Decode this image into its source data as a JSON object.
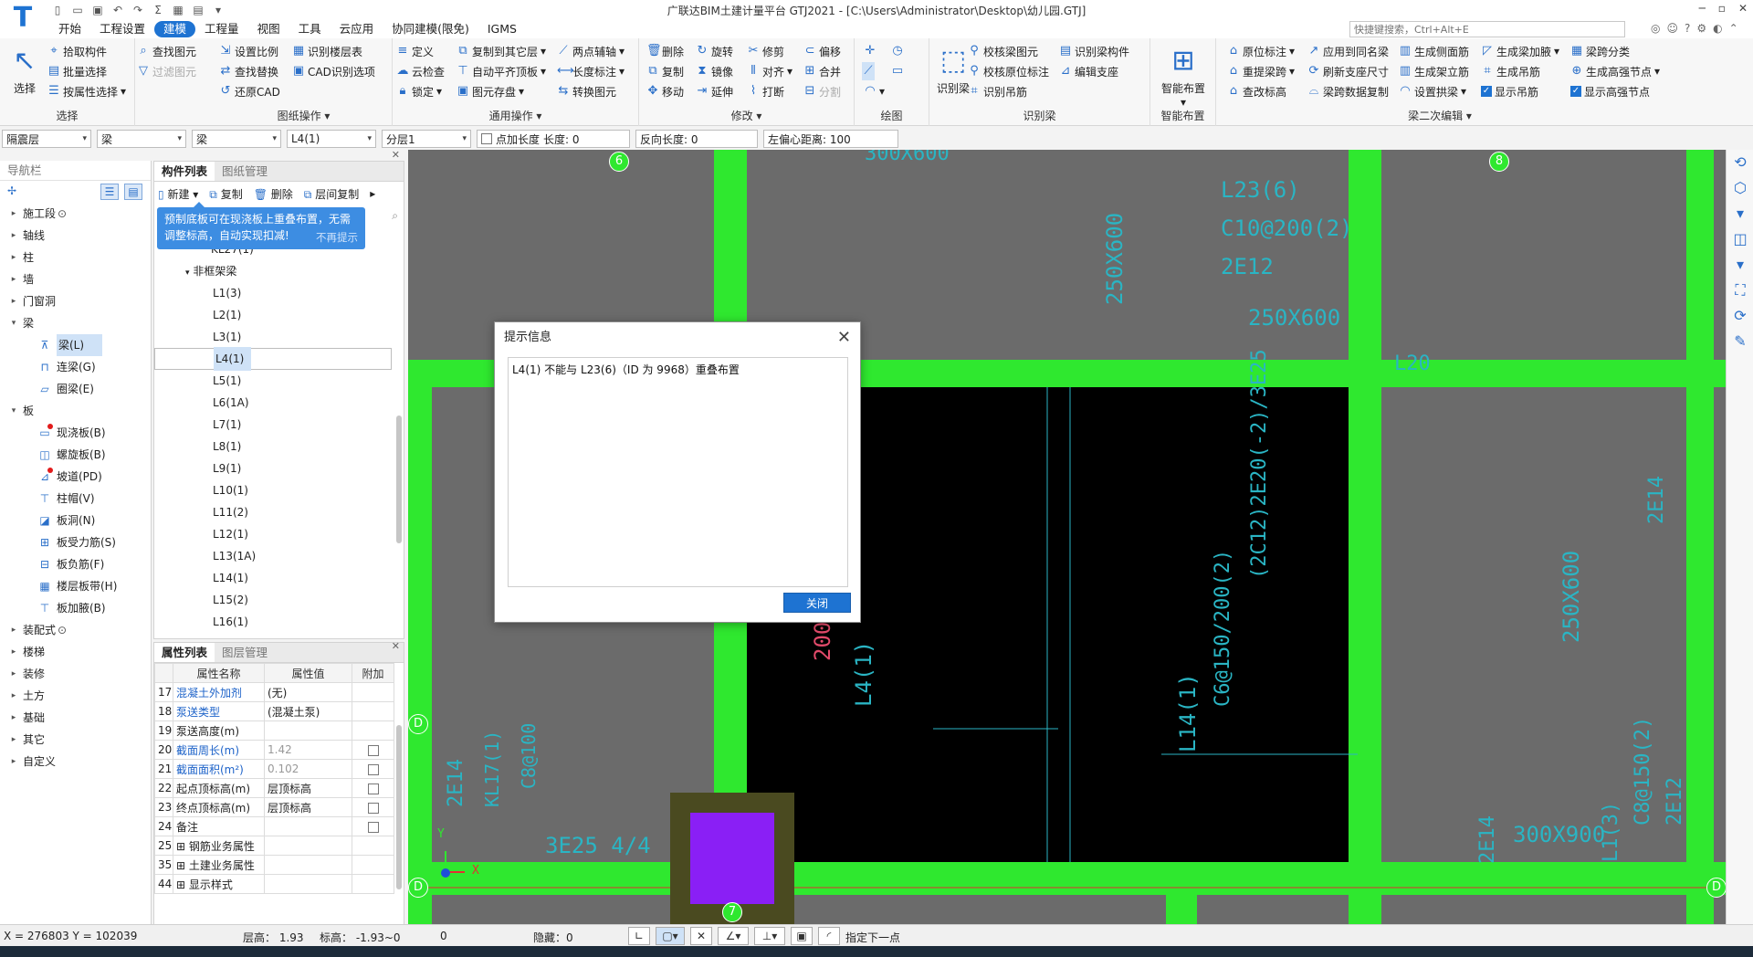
{
  "app": {
    "title": "广联达BIM土建计量平台 GTJ2021 - [C:\\Users\\Administrator\\Desktop\\幼儿园.GTJ]",
    "logo": "T"
  },
  "menus": [
    "开始",
    "工程设置",
    "建模",
    "工程量",
    "视图",
    "工具",
    "云应用",
    "协同建模(限免)",
    "IGMS"
  ],
  "active_menu": "建模",
  "search": {
    "placeholder": "快捷键搜索，Ctrl+Alt+E"
  },
  "ribbon": {
    "select": {
      "caption": "选择",
      "big": "选择",
      "items": [
        "拾取构件",
        "批量选择",
        "按属性选择",
        "查找图元",
        "过滤图元"
      ]
    },
    "drawing_ops": {
      "caption": "图纸操作",
      "items": [
        "设置比例",
        "查找替换",
        "还原CAD",
        "识别楼层表",
        "CAD识别选项"
      ]
    },
    "common_ops": {
      "caption": "通用操作",
      "items": [
        "定义",
        "云检查",
        "锁定",
        "复制到其它层",
        "自动平齐顶板",
        "图元存盘",
        "两点辅轴",
        "长度标注",
        "转换图元"
      ]
    },
    "modify": {
      "caption": "修改",
      "items": [
        "删除",
        "复制",
        "移动",
        "旋转",
        "镜像",
        "延伸",
        "修剪",
        "对齐",
        "打断",
        "偏移",
        "合并",
        "分割"
      ]
    },
    "draw": {
      "caption": "绘图"
    },
    "recognize_beam": {
      "caption": "识别梁",
      "big": "识别梁",
      "items": [
        "校核梁图元",
        "校核原位标注",
        "识别吊筋",
        "识别梁构件",
        "编辑支座"
      ]
    },
    "smart": {
      "caption": "智能布置",
      "big": "智能布置"
    },
    "beam_secondary": {
      "caption": "梁二次编辑",
      "items": [
        "原位标注",
        "重提梁跨",
        "查改标高",
        "应用到同名梁",
        "刷新支座尺寸",
        "梁跨数据复制",
        "生成侧面筋",
        "生成架立筋",
        "设置拱梁",
        "生成梁加腋",
        "生成吊筋",
        "显示吊筋",
        "梁跨分类",
        "生成高强节点",
        "显示高强节点"
      ]
    }
  },
  "filterbar": {
    "floor": "隔震层",
    "type1": "梁",
    "type2": "梁",
    "component": "L4(1)",
    "layer": "分层1",
    "add_length_label": "点加长度",
    "length_label": "长度: 0",
    "reverse_length": "反向长度: 0",
    "left_offset": "左偏心距离: 100"
  },
  "nav": {
    "title": "导航栏",
    "items": [
      {
        "label": "施工段",
        "suffix": "⊙",
        "level": 0
      },
      {
        "label": "轴线",
        "level": 0
      },
      {
        "label": "柱",
        "level": 0
      },
      {
        "label": "墙",
        "level": 0
      },
      {
        "label": "门窗洞",
        "level": 0
      },
      {
        "label": "梁",
        "level": 0,
        "open": true
      },
      {
        "label": "梁(L)",
        "level": 1,
        "icon": "beam-icon",
        "selected": true
      },
      {
        "label": "连梁(G)",
        "level": 1,
        "icon": "link-beam-icon"
      },
      {
        "label": "圈梁(E)",
        "level": 1,
        "icon": "ring-beam-icon"
      },
      {
        "label": "板",
        "level": 0,
        "open": true
      },
      {
        "label": "现浇板(B)",
        "level": 1,
        "icon": "slab-icon",
        "dot": true
      },
      {
        "label": "螺旋板(B)",
        "level": 1,
        "icon": "spiral-slab-icon"
      },
      {
        "label": "坡道(PD)",
        "level": 1,
        "icon": "ramp-icon",
        "dot": true
      },
      {
        "label": "柱帽(V)",
        "level": 1,
        "icon": "column-cap-icon"
      },
      {
        "label": "板洞(N)",
        "level": 1,
        "icon": "slab-hole-icon"
      },
      {
        "label": "板受力筋(S)",
        "level": 1,
        "icon": "slab-rebar-icon"
      },
      {
        "label": "板负筋(F)",
        "level": 1,
        "icon": "negative-rebar-icon"
      },
      {
        "label": "楼层板带(H)",
        "level": 1,
        "icon": "slab-band-icon"
      },
      {
        "label": "板加腋(B)",
        "level": 1,
        "icon": "slab-haunch-icon"
      },
      {
        "label": "装配式",
        "suffix": "⊙",
        "level": 0
      },
      {
        "label": "楼梯",
        "level": 0
      },
      {
        "label": "装修",
        "level": 0
      },
      {
        "label": "土方",
        "level": 0
      },
      {
        "label": "基础",
        "level": 0
      },
      {
        "label": "其它",
        "level": 0
      },
      {
        "label": "自定义",
        "level": 0
      }
    ]
  },
  "component_panel": {
    "tabs": [
      "构件列表",
      "图纸管理"
    ],
    "toolbar": [
      "新建",
      "复制",
      "删除",
      "层间复制"
    ],
    "tip": {
      "text": "预制底板可在现浇板上重叠布置，无需调整标高，自动实现扣减!",
      "dismiss": "不再提示"
    },
    "tree_top": "KL27(1)",
    "group": "非框架梁",
    "items": [
      "L1(3)",
      "L2(1)",
      "L3(1)",
      "L4(1)",
      "L5(1)",
      "L6(1A)",
      "L7(1)",
      "L8(1)",
      "L9(1)",
      "L10(1)",
      "L11(2)",
      "L12(1)",
      "L13(1A)",
      "L14(1)",
      "L15(2)",
      "L16(1)"
    ],
    "selected": "L4(1)"
  },
  "properties": {
    "tabs": [
      "属性列表",
      "图层管理"
    ],
    "headers": [
      "属性名称",
      "属性值",
      "附加"
    ],
    "rows": [
      {
        "n": "17",
        "name": "混凝土外加剂",
        "value": "(无)",
        "blue": true,
        "chk": false
      },
      {
        "n": "18",
        "name": "泵送类型",
        "value": "(混凝土泵)",
        "blue": true,
        "chk": false
      },
      {
        "n": "19",
        "name": "泵送高度(m)",
        "value": "",
        "blue": false,
        "chk": false
      },
      {
        "n": "20",
        "name": "截面周长(m)",
        "value": "1.42",
        "blue": true,
        "gray": true,
        "chk": true
      },
      {
        "n": "21",
        "name": "截面面积(m²)",
        "value": "0.102",
        "blue": true,
        "gray": true,
        "chk": true
      },
      {
        "n": "22",
        "name": "起点顶标高(m)",
        "value": "层顶标高",
        "blue": false,
        "chk": true
      },
      {
        "n": "23",
        "name": "终点顶标高(m)",
        "value": "层顶标高",
        "blue": false,
        "chk": true
      },
      {
        "n": "24",
        "name": "备注",
        "value": "",
        "blue": false,
        "chk": true
      },
      {
        "n": "25",
        "name": "钢筋业务属性",
        "value": "",
        "blue": false,
        "expand": true
      },
      {
        "n": "35",
        "name": "土建业务属性",
        "value": "",
        "blue": false,
        "expand": true
      },
      {
        "n": "44",
        "name": "显示样式",
        "value": "",
        "blue": false,
        "expand": true
      }
    ]
  },
  "canvas": {
    "axis_labels": [
      "6",
      "8",
      "7",
      "D",
      "D",
      "D"
    ],
    "texts": [
      "300X600",
      "250X600",
      "L23(6)",
      "C10@200(2)",
      "2E12",
      "250X600",
      "L20",
      "2E14",
      "250X600",
      "200X510",
      "L4(1)",
      "L14(1)",
      "C6@150/200(2)",
      "(2C12)2E20(-2)/3E25",
      "2E14",
      "2E14",
      "3E25 4/4",
      "300X900",
      "L1(3)",
      "C8@150(2)",
      "2E12",
      "KL17(1)",
      "C8@100",
      "Y",
      "X"
    ],
    "colors": {
      "beam": "#2fe82f",
      "bg": "#6b6b6b",
      "slab": "#000000",
      "column": "#8a1ff5",
      "annot_cyan": "#2ab5c4",
      "annot_red": "#e24a6a"
    }
  },
  "dialog": {
    "title": "提示信息",
    "message": "L4(1) 不能与 L23(6)（ID 为 9968）重叠布置",
    "close_label": "关闭"
  },
  "status": {
    "coords": "X = 276803 Y = 102039",
    "floor_height": "层高： 1.93",
    "elevation": "标高： -1.93~0",
    "zero": "0",
    "hidden": "隐藏：0",
    "prompt": "指定下一点"
  }
}
